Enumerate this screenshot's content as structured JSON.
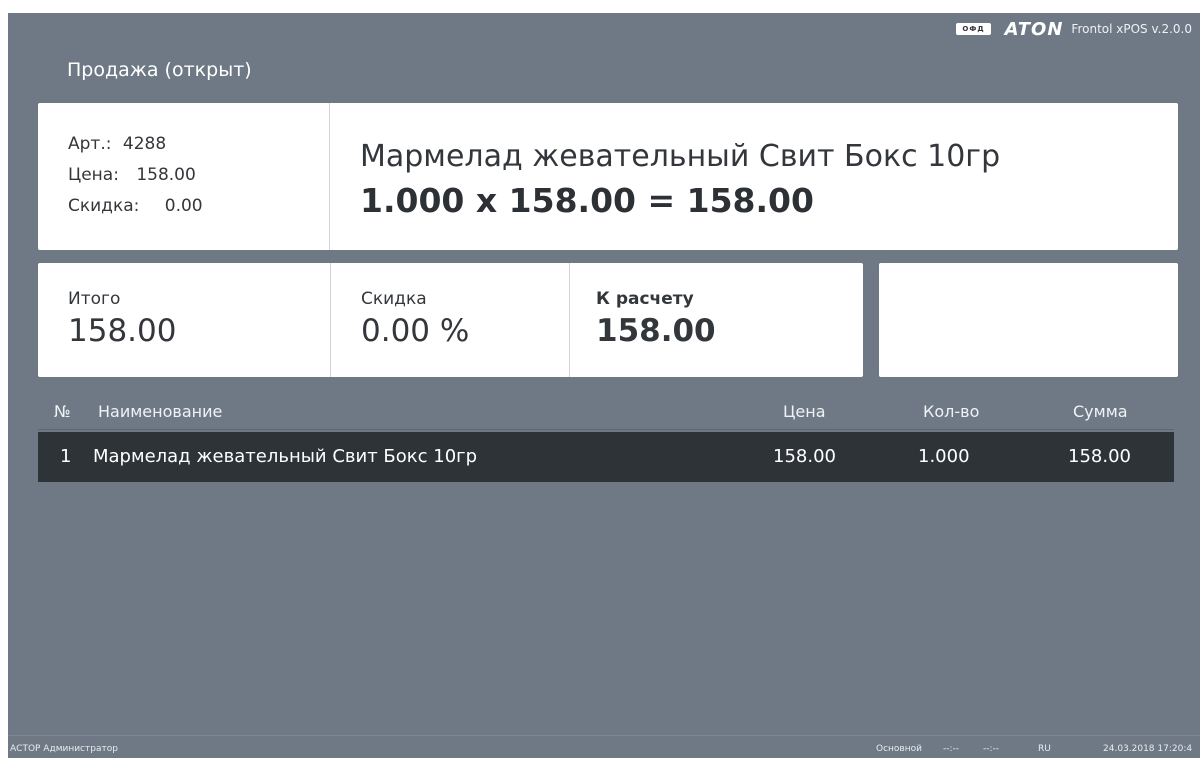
{
  "header": {
    "ofd_badge": "ОФД",
    "brand": "ATON",
    "version": "Frontol xPOS v.2.0.0",
    "mode_title": "Продажа (открыт)"
  },
  "item": {
    "article_label": "Арт.:",
    "article_value": "4288",
    "price_label": "Цена:",
    "price_value": "158.00",
    "discount_label": "Скидка:",
    "discount_value": "0.00",
    "name": "Мармелад жевательный Свит Бокс 10гр",
    "calc": "1.000 x 158.00 = 158.00"
  },
  "totals": {
    "total_label": "Итого",
    "total_value": "158.00",
    "discount_label": "Скидка",
    "discount_value": "0.00 %",
    "due_label": "К расчету",
    "due_value": "158.00"
  },
  "table": {
    "columns": {
      "num": "№",
      "name": "Наименование",
      "price": "Цена",
      "qty": "Кол-во",
      "sum": "Сумма"
    },
    "rows": [
      {
        "num": "1",
        "name": "Мармелад жевательный Свит Бокс 10гр",
        "price": "158.00",
        "qty": "1.000",
        "sum": "158.00"
      }
    ]
  },
  "status": {
    "user": "АСТОР Администратор",
    "profile": "Основной",
    "field1": "--:--",
    "field2": "--:--",
    "language": "RU",
    "datetime": "24.03.2018 17:20:4"
  }
}
